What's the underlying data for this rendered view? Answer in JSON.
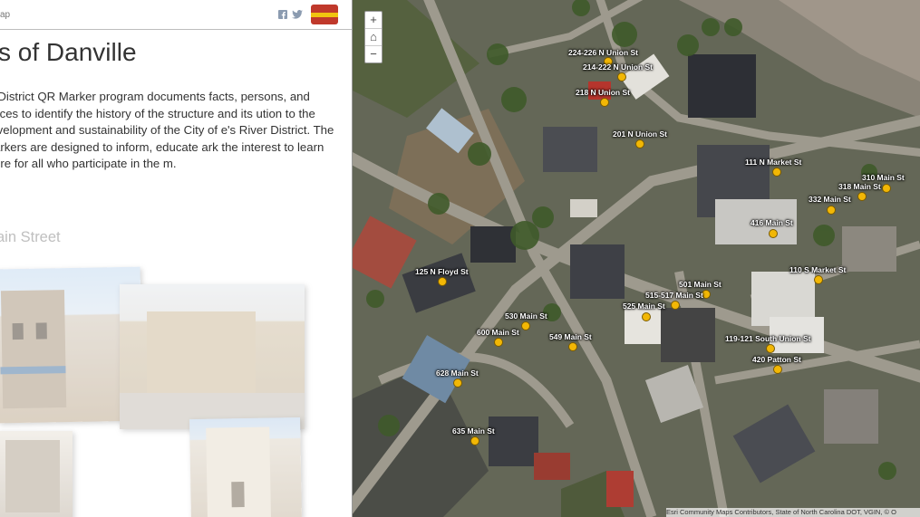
{
  "header": {
    "app_label": "ap",
    "facebook_icon": "f",
    "twitter_icon": "t"
  },
  "story": {
    "title": "s of Danville",
    "description": "er District QR Marker program documents facts, persons, and places to identify the history of the structure and its ution to the development and sustainability of the City of e's River District. The markers are designed to inform, educate ark the interest to learn more for all who participate in the m.",
    "section_heading": "ain Street"
  },
  "map": {
    "zoom_in": "+",
    "home": "⌂",
    "zoom_out": "−",
    "attribution": "Esri Community Maps Contributors, State of North Carolina DOT, VGIN, © O",
    "markers": [
      "224-226 N Union St",
      "214-222 N Union St",
      "218 N Union St",
      "201 N Union St",
      "111 N Market St",
      "310 Main St",
      "318 Main St",
      "332 Main St",
      "416 Main St",
      "125 N Floyd St",
      "110 S Market St",
      "501 Main St",
      "515-517 Main St",
      "525 Main St",
      "530 Main St",
      "600 Main St",
      "549 Main St",
      "119-121 South Union St",
      "420 Patton St",
      "628 Main St",
      "635 Main St"
    ]
  }
}
